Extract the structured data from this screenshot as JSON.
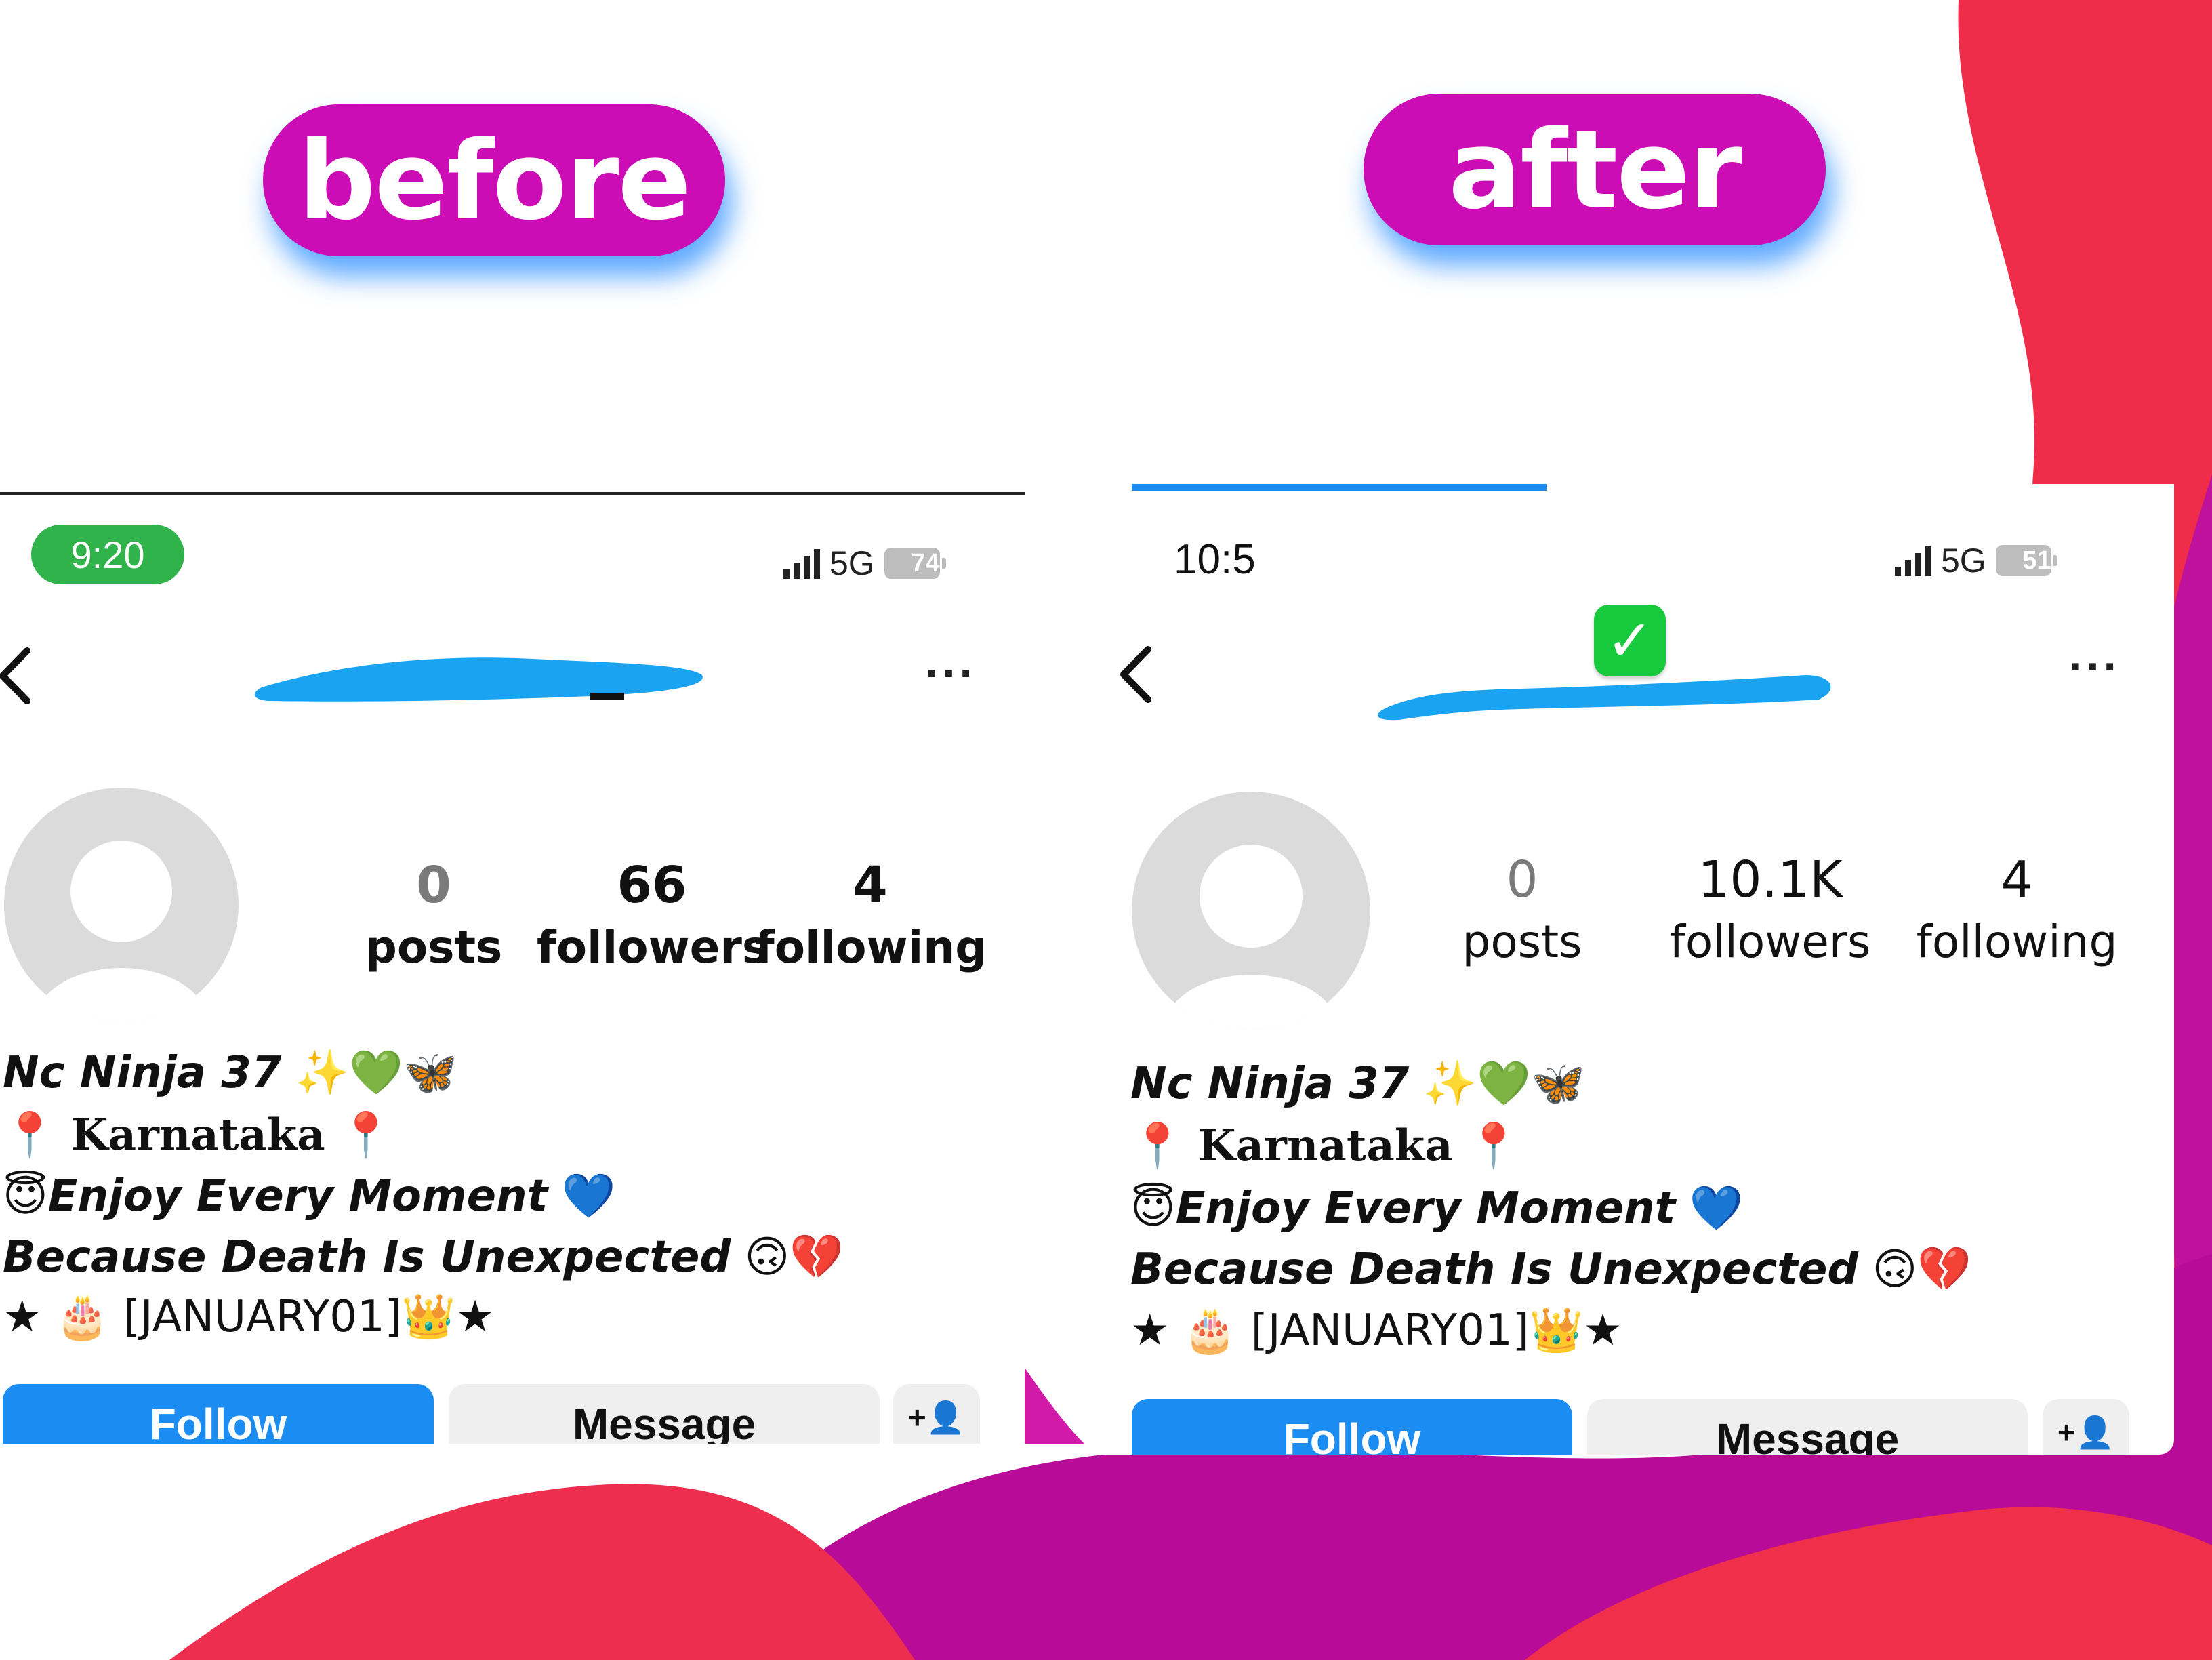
{
  "labels": {
    "before": "before",
    "after": "after"
  },
  "before": {
    "time": "9:20",
    "network": "5G",
    "battery": "74",
    "battery_level": 0.74,
    "menu_dots": "...",
    "stats": [
      {
        "value": "0",
        "label": "posts"
      },
      {
        "value": "66",
        "label": "followers"
      },
      {
        "value": "4",
        "label": "following"
      }
    ],
    "bio": {
      "line1": "Nc Ninja 37",
      "line1_emoji": "✨💚🦋",
      "line2": "Karnataka",
      "line2_pin": "📍",
      "line3": "Enjoy Every Moment",
      "line3_pre": "😇",
      "line3_post": "💙",
      "line4": "Because Death Is Unexpected",
      "line4_emoji": "🙃💔",
      "line5_pre": "★ 🎂 ",
      "line5": "[JANUARY01]",
      "line5_post": "👑★"
    },
    "buttons": {
      "follow": "Follow",
      "message": "Message",
      "add": "+👤"
    },
    "verified": false
  },
  "after": {
    "time": "10:5",
    "network": "5G",
    "battery": "51",
    "battery_level": 0.51,
    "menu_dots": "...",
    "verified_icon": "✓",
    "stats": [
      {
        "value": "0",
        "label": "posts"
      },
      {
        "value": "10.1K",
        "label": "followers"
      },
      {
        "value": "4",
        "label": "following"
      }
    ],
    "bio": {
      "line1": "Nc Ninja 37",
      "line1_emoji": "✨💚🦋",
      "line2": "Karnataka",
      "line2_pin": "📍",
      "line3": "Enjoy Every Moment",
      "line3_pre": "😇",
      "line3_post": "💙",
      "line4": "Because Death Is Unexpected",
      "line4_emoji": "🙃💔",
      "line5_pre": "★ 🎂 ",
      "line5": "[JANUARY01]",
      "line5_post": "👑★"
    },
    "buttons": {
      "follow": "Follow",
      "message": "Message",
      "add": "+👤"
    },
    "verified": true
  },
  "colors": {
    "pill": "#cc0cb5",
    "pill_glow": "#288cff",
    "follow": "#1a8cf2",
    "redaction": "#1aa3f0",
    "verified": "#17c93c",
    "time_pill": "#2fb34a",
    "bg_magenta": "#c0119c",
    "bg_red": "#f0304a"
  }
}
